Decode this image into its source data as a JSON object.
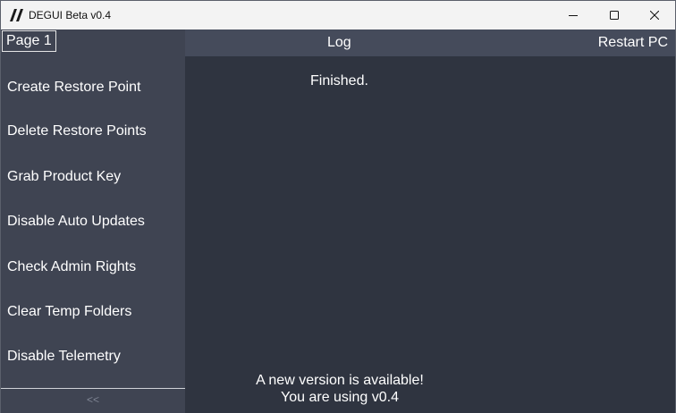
{
  "window": {
    "title": "DEGUI Beta v0.4",
    "icons": {
      "app": "degui-logo-icon",
      "minimize": "minimize-icon",
      "maximize": "maximize-icon",
      "close": "close-icon"
    }
  },
  "sidebar": {
    "page_label": "Page 1",
    "items": [
      {
        "label": "Create Restore Point"
      },
      {
        "label": "Delete Restore Points"
      },
      {
        "label": "Grab Product Key"
      },
      {
        "label": "Disable Auto Updates"
      },
      {
        "label": "Check Admin Rights"
      },
      {
        "label": "Clear Temp Folders"
      },
      {
        "label": "Disable Telemetry"
      }
    ],
    "collapse_label": "<<"
  },
  "header": {
    "log_title": "Log",
    "restart_label": "Restart PC"
  },
  "log": {
    "text": "Finished."
  },
  "update": {
    "line1": "A new version is available!",
    "line2": "You are using v0.4"
  },
  "colors": {
    "sidebar_bg": "#3f4452",
    "main_bg": "#2f3440",
    "topbar_bg": "#454b5b",
    "titlebar_bg": "#f3f3f3",
    "text": "#ffffff",
    "muted": "#7f8594"
  }
}
